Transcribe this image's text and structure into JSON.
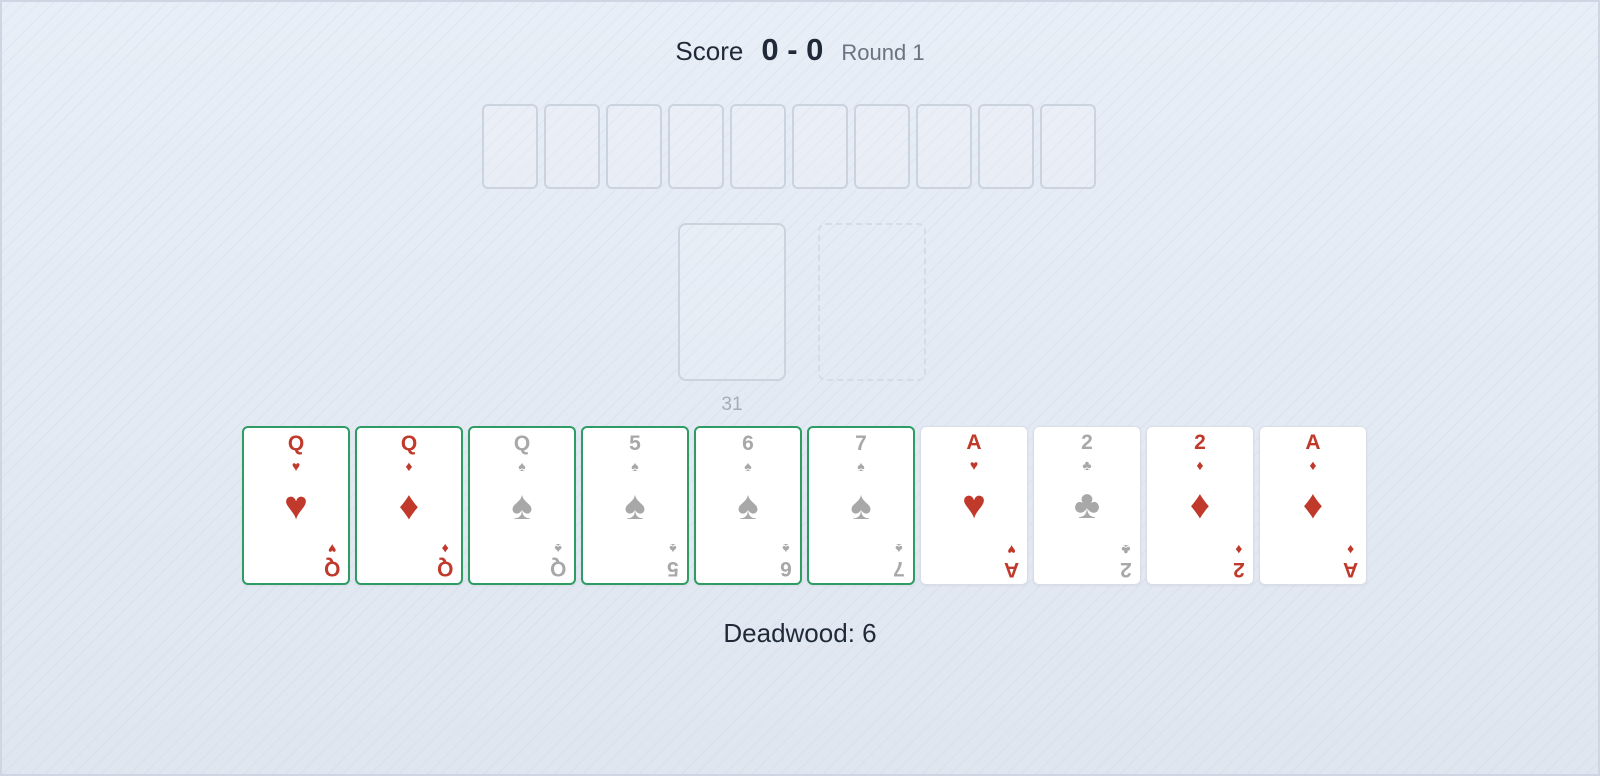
{
  "score": {
    "label": "Score",
    "value": "0 - 0",
    "round": "Round 1"
  },
  "stock": {
    "count": "31"
  },
  "colors": {
    "red": "#c0392b",
    "gray": "#a8a8a8",
    "meld_border": "#2e9c63"
  },
  "hand": [
    {
      "rank": "Q",
      "suit": "♥",
      "suit_name": "hearts",
      "color": "red",
      "melded": true
    },
    {
      "rank": "Q",
      "suit": "♦",
      "suit_name": "diamonds",
      "color": "red",
      "melded": true
    },
    {
      "rank": "Q",
      "suit": "♠",
      "suit_name": "spades",
      "color": "gray",
      "melded": true
    },
    {
      "rank": "5",
      "suit": "♠",
      "suit_name": "spades",
      "color": "gray",
      "melded": true
    },
    {
      "rank": "6",
      "suit": "♠",
      "suit_name": "spades",
      "color": "gray",
      "melded": true
    },
    {
      "rank": "7",
      "suit": "♠",
      "suit_name": "spades",
      "color": "gray",
      "melded": true
    },
    {
      "rank": "A",
      "suit": "♥",
      "suit_name": "hearts",
      "color": "red",
      "melded": false
    },
    {
      "rank": "2",
      "suit": "♣",
      "suit_name": "clubs",
      "color": "gray",
      "melded": false
    },
    {
      "rank": "2",
      "suit": "♦",
      "suit_name": "diamonds",
      "color": "red",
      "melded": false
    },
    {
      "rank": "A",
      "suit": "♦",
      "suit_name": "diamonds",
      "color": "red",
      "melded": false
    }
  ],
  "deadwood": "Deadwood: 6"
}
